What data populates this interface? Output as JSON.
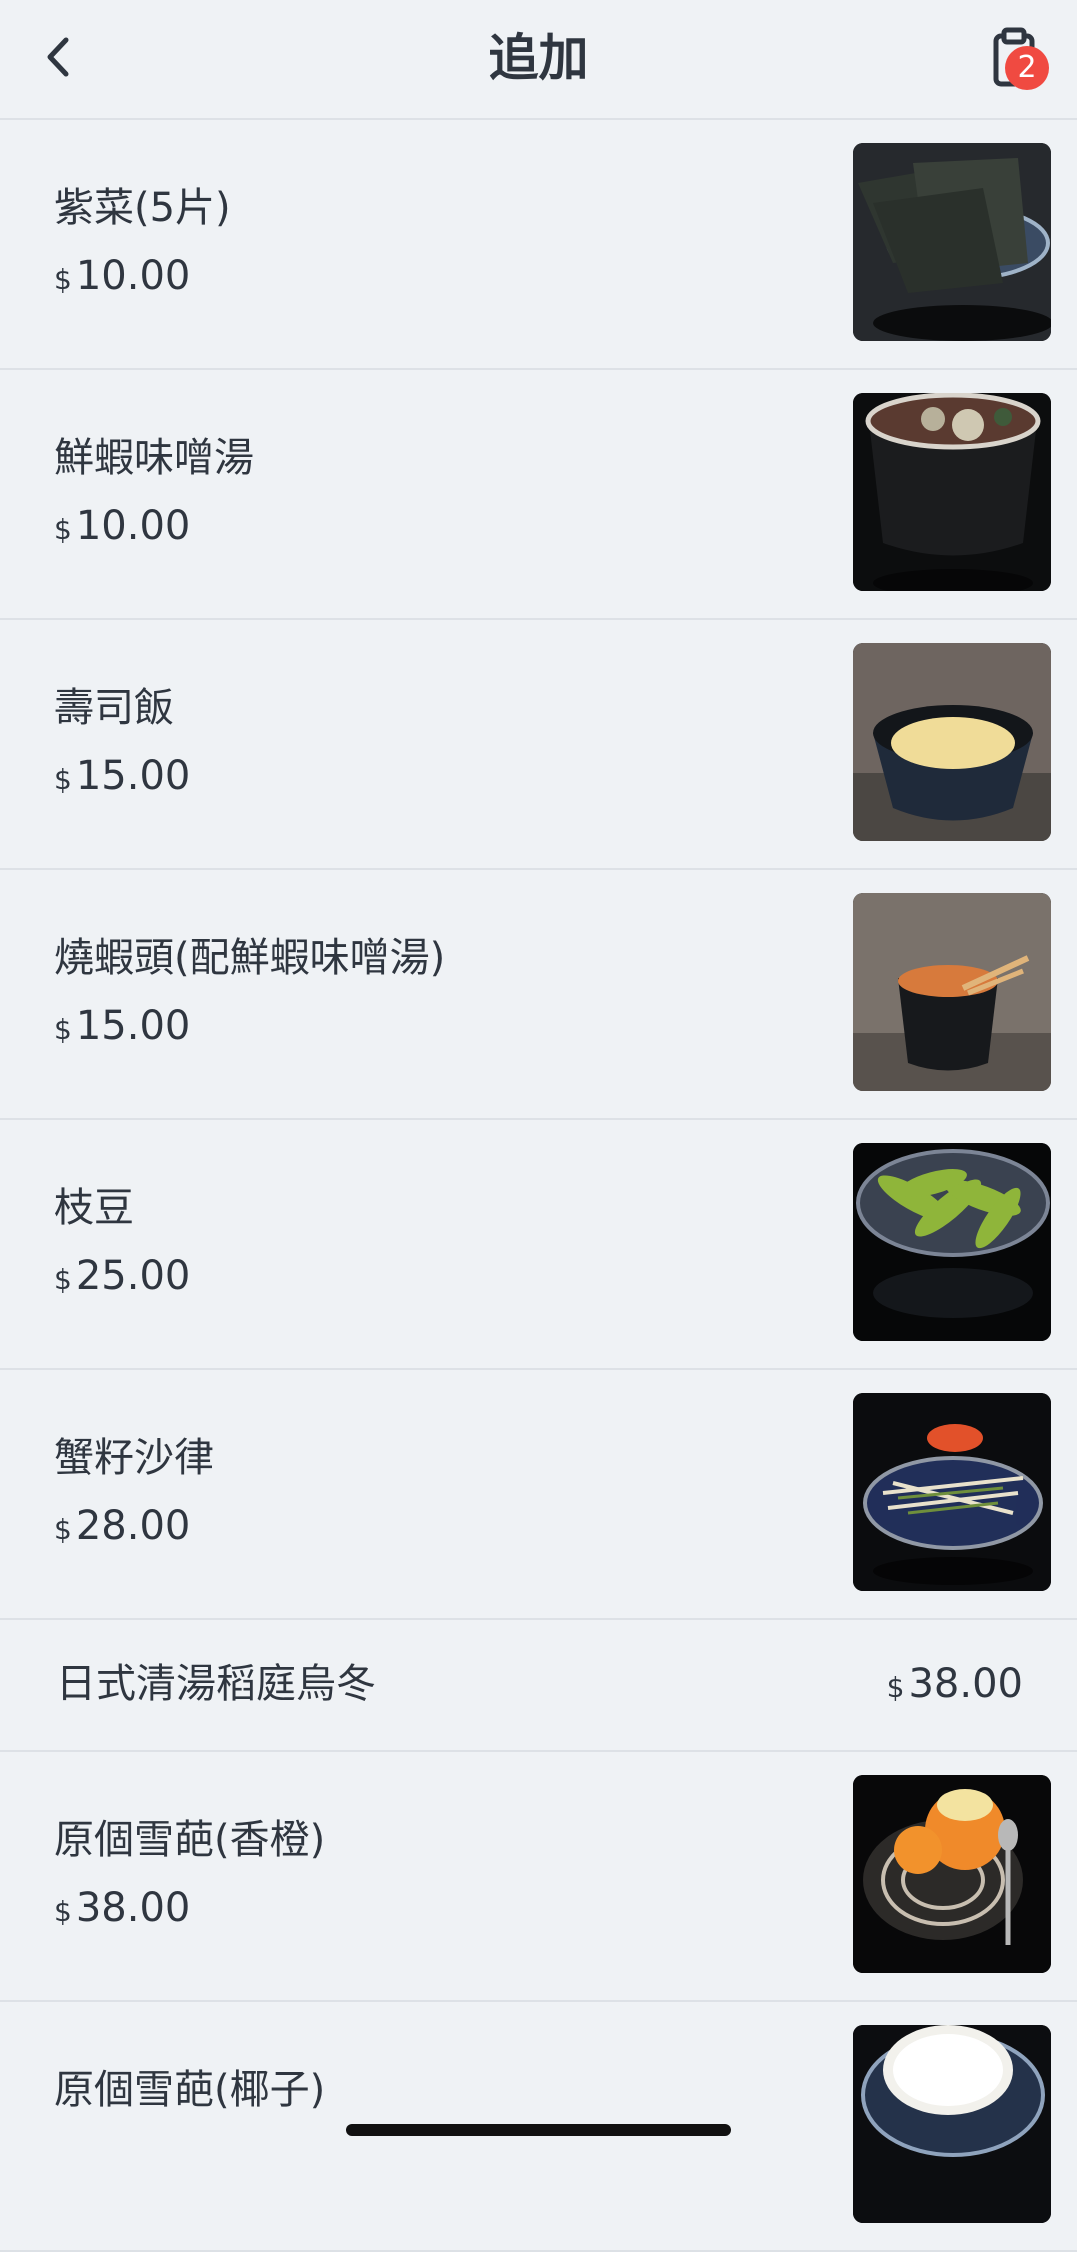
{
  "header": {
    "title": "追加",
    "cart_badge": "2"
  },
  "currency_symbol": "$",
  "items": [
    {
      "name": "紫菜(5片)",
      "price": "10.00",
      "image": "seaweed-image"
    },
    {
      "name": "鮮蝦味噌湯",
      "price": "10.00",
      "image": "miso-soup-image"
    },
    {
      "name": "壽司飯",
      "price": "15.00",
      "image": "sushi-rice-image"
    },
    {
      "name": "燒蝦頭(配鮮蝦味噌湯)",
      "price": "15.00",
      "image": "shrimp-head-soup-image"
    },
    {
      "name": "枝豆",
      "price": "25.00",
      "image": "edamame-image"
    },
    {
      "name": "蟹籽沙律",
      "price": "28.00",
      "image": "crab-roe-salad-image"
    },
    {
      "name": "日式清湯稻庭烏冬",
      "price": "38.00"
    },
    {
      "name": "原個雪葩(香橙)",
      "price": "38.00",
      "image": "orange-sorbet-image"
    },
    {
      "name": "原個雪葩(椰子)",
      "image": "coconut-sorbet-image"
    }
  ],
  "colors": {
    "background": "#eff2f5",
    "text": "#2f3640",
    "badge": "#f04a41",
    "divider": "#dde1e6"
  }
}
